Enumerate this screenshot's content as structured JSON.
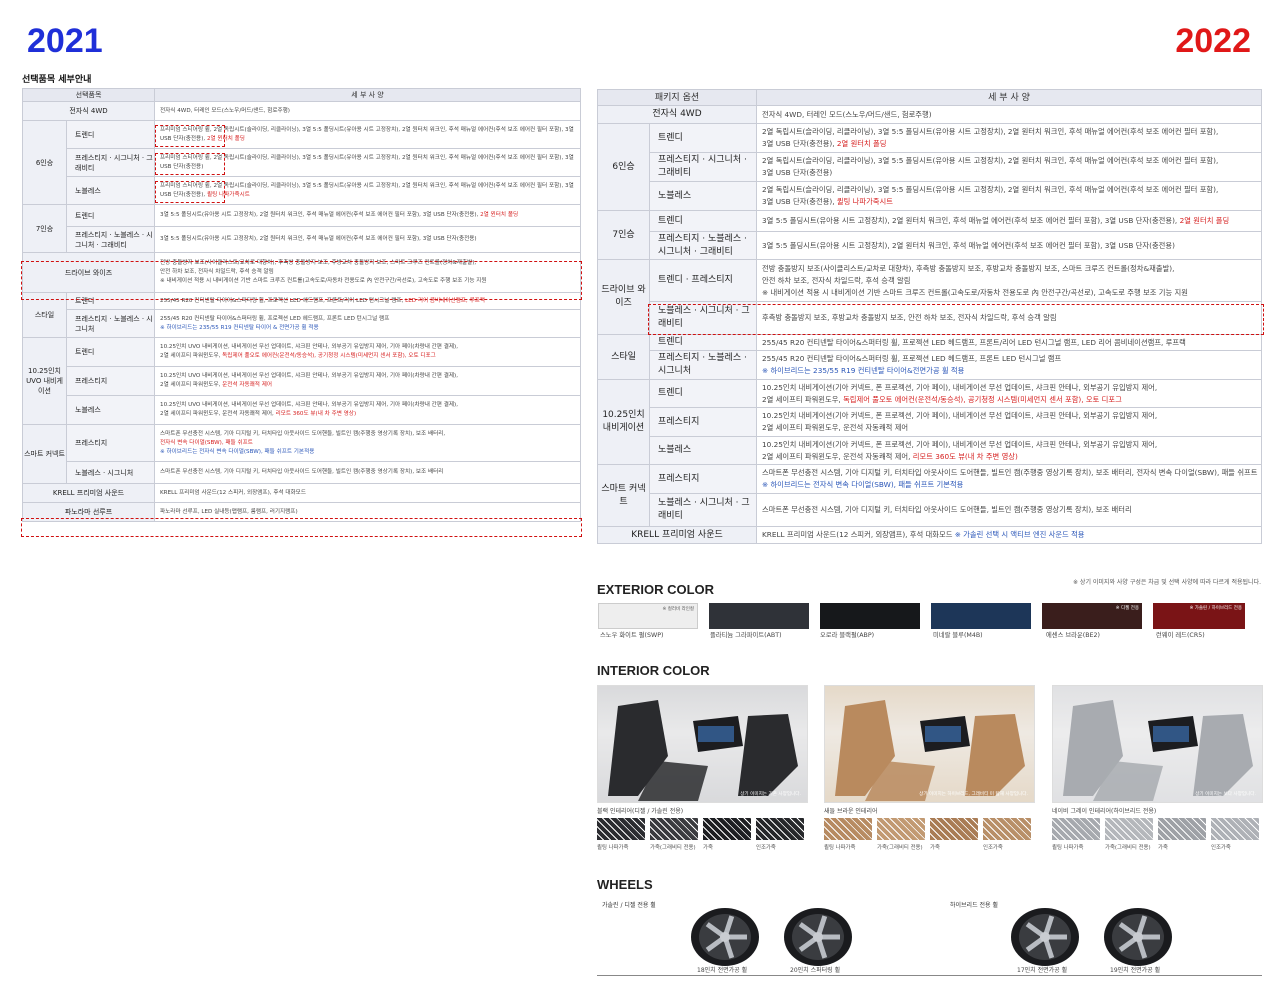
{
  "years": {
    "left": "2021",
    "right": "2022"
  },
  "left_table": {
    "section_title": "선택품목 세부안내",
    "headers": [
      "선택품목",
      "세 부 사 양"
    ],
    "awd": {
      "name": "전자식 4WD",
      "spec": "전자식 4WD, 터레인 모드(스노우/머드/샌드, 험로주행)"
    },
    "six_seat": {
      "group": "6인승",
      "trendy": {
        "name": "트렌디",
        "spec": "프리미엄 스티어링 휠, 2열 독립시트(슬라이딩, 리클라이닝), 3열 5:5 폴딩시트(유아용 시트 고정장치), 2열 원터치 워크인, 후석 매뉴얼 에어컨(후석 보조 에어컨 필터 포함), 3열 USB 단자(충전용),",
        "spec_red": "2열 윈터치 폴딩"
      },
      "prestige": {
        "name": "프레스티지 · 시그니처 · 그래비티",
        "spec": "프리미엄 스티어링 휠, 2열 독립시트(슬라이딩, 리클라이닝), 3열 5:5 폴딩시트(유아용 시트 고정장치), 2열 원터치 워크인, 후석 매뉴얼 에어컨(후석 보조 에어컨 필터 포함), 3열 USB 단자(충전용)"
      },
      "noblesse": {
        "name": "노블레스",
        "spec": "프리미엄 스티어링 휠, 2열 독립시트(슬라이딩, 리클라이닝), 3열 5:5 폴딩시트(유아용 시트 고정장치), 2열 원터치 워크인, 후석 매뉴얼 에어컨(후석 보조 에어컨 필터 포함), 3열 USB 단자(충전용),",
        "spec_red": "퀼팅 나파가죽시트"
      }
    },
    "seven_seat": {
      "group": "7인승",
      "trendy": {
        "name": "트렌디",
        "spec": "3열 5:5 폴딩시트(유아용 시트 고정장치), 2열 원터치 워크인, 후석 매뉴얼 에어컨(후석 보조 에어컨 필터 포함), 3열 USB 단자(충전용),",
        "spec_red": "2열 윈터치 폴딩"
      },
      "prestige": {
        "name": "프레스티지 · 노블레스 · 시그니처 · 그래비티",
        "spec": "3열 5:5 폴딩시트(유아용 시트 고정장치), 2열 원터치 워크인, 후석 매뉴얼 에어컨(후석 보조 에어컨 필터 포함), 3열 USB 단자(충전용)"
      }
    },
    "drive_wise": {
      "name": "드라이브 와이즈",
      "spec1": "전방 충돌방지 보조(사이클리스트/교차로 대향차), 후측방 충돌방지 보조, 후방교차 충돌방지 보조, 스마트 크루즈 컨트롤(정차&재출발),",
      "spec2": "안전 하차 보조, 전자식 차일드락, 후석 승객 알림",
      "spec3": "※ 내비게이션 적용 시 내비게이션 기반 스마트 크루즈 컨트롤(고속도로/자동차 전용도로 內 안전구간/곡선로), 고속도로 주행 보조 기능 지원"
    },
    "style": {
      "group": "스타일",
      "trendy": {
        "name": "트렌디",
        "spec": "255/45 R20 컨티넨탈 타이어&스퍼터링 휠, 프로젝션 LED 헤드램프, 프론트/리어 LED 턴시그널 램프,",
        "spec_red": "LED 리어 콤비네이션램프, 루프랙"
      },
      "prestige": {
        "name": "프레스티지 · 노블레스 · 시그니처",
        "spec": "255/45 R20 컨티넨탈 타이어&스퍼터링 휠, 프로젝션 LED 헤드램프, 프론트 LED 턴시그널 램프",
        "spec_blue": "※ 하이브리드는 235/55 R19 컨티넨탈 타이어 & 전면가공 휠 적용"
      }
    },
    "nav": {
      "group": "10.25인치 UVO 내비게이션",
      "trendy": {
        "name": "트렌디",
        "spec1": "10.25인치 UVO 내비게이션, 내비게이션 무선 업데이트, 샤크핀 안테나, 외부공기 유입방지 제어, 기아 페이(차량내 간편 결제),",
        "spec2": "2열 세이프티 파워윈도우,",
        "spec_red": "독립제어 풀오토 에어컨(운전석/동승석), 공기청정 시스템(미세먼지 센서 포함), 오토 디포그"
      },
      "prestige": {
        "name": "프레스티지",
        "spec1": "10.25인치 UVO 내비게이션, 내비게이션 무선 업데이트, 샤크핀 안테나, 외부공기 유입방지 제어, 기아 페이(차량내 간편 결제),",
        "spec2": "2열 세이프티 파워윈도우,",
        "spec_red": "운전석 자동쾌적 제어"
      },
      "noblesse": {
        "name": "노블레스",
        "spec1": "10.25인치 UVO 내비게이션, 내비게이션 무선 업데이트, 샤크핀 안테나, 외부공기 유입방지 제어, 기아 페이(차량내 간편 결제),",
        "spec2": "2열 세이프티 파워윈도우, 운전석 자동쾌적 제어,",
        "spec_red": "리모트 360도 뷰(내 차 주변 영상)"
      }
    },
    "smart": {
      "group": "스마트 커넥트",
      "prestige": {
        "name": "프레스티지",
        "spec": "스마트폰 무선충전 시스템, 기아 디지털 키, 터치타입 아웃사이드 도어핸들, 빌트인 캠(주행중 영상기록 장치), 보조 배터리,",
        "spec_red": "전자식 변속 다이얼(SBW), 패들 쉬프트",
        "spec_blue": "※ 하이브리드는 전자식 변속 다이얼(SBW), 패들 쉬프트 기본적용"
      },
      "noblesse": {
        "name": "노블레스 · 시그니처",
        "spec": "스마트폰 무선충전 시스템, 기아 디지털 키, 터치타입 아웃사이드 도어핸들, 빌트인 캠(주행중 영상기록 장치), 보조 배터리"
      }
    },
    "krell": {
      "name": "KRELL 프리미엄 사운드",
      "spec": "KRELL 프리미엄 사운드(12 스피커, 외장앰프), 후석 대화모드"
    },
    "panorama": {
      "name": "파노라마 선루프",
      "spec": "파노라마 선루프, LED 실내등(맵램프, 룸램프, 러기지램프)"
    }
  },
  "right_table": {
    "headers": [
      "패키지 옵션",
      "세 부 사 양"
    ],
    "awd": {
      "name": "전자식 4WD",
      "spec": "전자식 4WD, 터레인 모드(스노우/머드/샌드, 험로주행)"
    },
    "six_seat": {
      "group": "6인승",
      "trendy": {
        "name": "트렌디",
        "spec1": "2열 독립시트(슬라이딩, 리클라이닝), 3열 5:5 폴딩시트(유아용 시트 고정장치), 2열 원터치 워크인, 후석 매뉴얼 에어컨(후석 보조 에어컨 필터 포함),",
        "spec2": "3열 USB 단자(충전용),",
        "spec_red": "2열 원터치 폴딩"
      },
      "prestige": {
        "name": "프레스티지 · 시그니처 · 그래비티",
        "spec1": "2열 독립시트(슬라이딩, 리클라이닝), 3열 5:5 폴딩시트(유아용 시트 고정장치), 2열 원터치 워크인, 후석 매뉴얼 에어컨(후석 보조 에어컨 필터 포함),",
        "spec2": "3열 USB 단자(충전용)"
      },
      "noblesse": {
        "name": "노블레스",
        "spec1": "2열 독립시트(슬라이딩, 리클라이닝), 3열 5:5 폴딩시트(유아용 시트 고정장치), 2열 원터치 워크인, 후석 매뉴얼 에어컨(후석 보조 에어컨 필터 포함),",
        "spec2": "3열 USB 단자(충전용),",
        "spec_red": "퀼팅 나파가죽시트"
      }
    },
    "seven_seat": {
      "group": "7인승",
      "trendy": {
        "name": "트렌디",
        "spec": "3열 5:5 폴딩시트(유아용 시트 고정장치), 2열 원터치 워크인, 후석 매뉴얼 에어컨(후석 보조 에어컨 필터 포함), 3열 USB 단자(충전용),",
        "spec_red": "2열 원터치 폴딩"
      },
      "prestige": {
        "name": "프레스티지 · 노블레스 · 시그니처 · 그래비티",
        "spec": "3열 5:5 폴딩시트(유아용 시트 고정장치), 2열 원터치 워크인, 후석 매뉴얼 에어컨(후석 보조 에어컨 필터 포함), 3열 USB 단자(충전용)"
      }
    },
    "drive_wise": {
      "group": "드라이브 와이즈",
      "trendy": {
        "name": "트렌디 · 프레스티지",
        "spec1": "전방 충돌방지 보조(사이클리스트/교차로 대향차), 후측방 충돌방지 보조, 후방교차 충돌방지 보조, 스마트 크루즈 컨트롤(정차&재출발),",
        "spec2": "안전 하차 보조, 전자식 차일드락, 후석 승객 알림",
        "spec3": "※ 내비게이션 적용 시 내비게이션 기반 스마트 크루즈 컨트롤(고속도로/자동차 전용도로 內 안전구간/곡선로), 고속도로 주행 보조 기능 지원"
      },
      "noblesse": {
        "name": "노블레스 · 시그니처 · 그래비티",
        "spec": "후측방 충돌방지 보조, 후방교차 충돌방지 보조, 안전 하차 보조, 전자식 차일드락, 후석 승객 알림"
      }
    },
    "style": {
      "group": "스타일",
      "trendy": {
        "name": "트렌디",
        "spec": "255/45 R20 컨티넨탈 타이어&스퍼터링 휠, 프로젝션 LED 헤드램프, 프론트/리어 LED 턴시그널 램프, LED 리어 콤비네이션램프, 루프랙"
      },
      "prestige": {
        "name": "프레스티지 · 노블레스 · 시그니처",
        "spec": "255/45 R20 컨티넨탈 타이어&스퍼터링 휠, 프로젝션 LED 헤드램프, 프론트 LED 턴시그널 램프",
        "spec_blue": "※ 하이브리드는 235/55 R19 컨티넨탈 타이어&전면가공 휠 적용"
      }
    },
    "nav": {
      "group": "10.25인치 내비게이션",
      "trendy": {
        "name": "트렌디",
        "spec1": "10.25인치 내비게이션(기아 커넥트, 폰 프로젝션, 기아 페이), 내비게이션 무선 업데이트, 샤크핀 안테나, 외부공기 유입방지 제어,",
        "spec2": "2열 세이프티 파워윈도우,",
        "spec_red": "독립제어 풀오토 에어컨(운전석/동승석), 공기청정 시스템(미세먼지 센서 포함), 오토 디포그"
      },
      "prestige": {
        "name": "프레스티지",
        "spec1": "10.25인치 내비게이션(기아 커넥트, 폰 프로젝션, 기아 페이), 내비게이션 무선 업데이트, 샤크핀 안테나, 외부공기 유입방지 제어,",
        "spec2": "2열 세이프티 파워윈도우, 운전석 자동쾌적 제어"
      },
      "noblesse": {
        "name": "노블레스",
        "spec1": "10.25인치 내비게이션(기아 커넥트, 폰 프로젝션, 기아 페이), 내비게이션 무선 업데이트, 샤크핀 안테나, 외부공기 유입방지 제어,",
        "spec2": "2열 세이프티 파워윈도우, 운전석 자동쾌적 제어,",
        "spec_red": "리모트 360도 뷰(내 차 주변 영상)"
      }
    },
    "smart": {
      "group": "스마트 커넥트",
      "prestige": {
        "name": "프레스티지",
        "spec": "스마트폰 무선충전 시스템, 기아 디지털 키, 터치타입 아웃사이드 도어핸들, 빌트인 캠(주행중 영상기록 장치), 보조 배터리, 전자식 변속 다이얼(SBW), 패들 쉬프트",
        "spec_blue": "※ 하이브리드는 전자식 변속 다이얼(SBW), 패들 쉬프트 기본적용"
      },
      "noblesse": {
        "name": "노블레스 · 시그니처 · 그래비티",
        "spec": "스마트폰 무선충전 시스템, 기아 디지털 키, 터치타입 아웃사이드 도어핸들, 빌트인 캠(주행중 영상기록 장치), 보조 배터리"
      }
    },
    "krell": {
      "name": "KRELL 프리미엄 사운드",
      "spec": "KRELL 프리미엄 사운드(12 스피커, 외장앰프), 후석 대화모드",
      "spec_blue": "※ 가솔린 선택 시 액티브 엔진 사운드 적용"
    }
  },
  "exterior": {
    "title": "EXTERIOR COLOR",
    "note": "※ 상기 이미지와 사양 구성은 차급 및 선택 사양에 따라 다르게 적용됩니다.",
    "colors": [
      {
        "name": "스노우 화이트 펄(SWP)",
        "hex": "#eeeeee",
        "tag": "※ 컬러비 라인컬"
      },
      {
        "name": "플라티늄 그라파이트(ABT)",
        "hex": "#2f3238",
        "tag": ""
      },
      {
        "name": "오로라 블랙펄(ABP)",
        "hex": "#16181b",
        "tag": ""
      },
      {
        "name": "미네랄 블루(M4B)",
        "hex": "#1d3658",
        "tag": ""
      },
      {
        "name": "에센스 브라운(BE2)",
        "hex": "#3a1e1c",
        "tag": "※ 디젤 전용"
      },
      {
        "name": "런웨이 레드(CR5)",
        "hex": "#7a1416",
        "tag": "※ 가솔린 / 하이브리드 전용"
      }
    ]
  },
  "interior": {
    "title": "INTERIOR COLOR",
    "caption": "상기 이미지는 기존 사양입니다.",
    "items": [
      {
        "name": "블랙 인테리어(디젤 / 가솔린 전용)",
        "seat": "#2a2b2e",
        "bg": "#d9dadc",
        "textures": [
          {
            "label": "퀼팅 나파가죽",
            "hex": "#2b2c30"
          },
          {
            "label": "가죽(그래비티 전용)",
            "hex": "#3a3b3f"
          },
          {
            "label": "가죽",
            "hex": "#1e1f22"
          },
          {
            "label": "인조가죽",
            "hex": "#26272a"
          }
        ]
      },
      {
        "name": "새들 브라운 인테리어",
        "seat": "#b98a5e",
        "bg": "#e5d9c9",
        "textures": [
          {
            "label": "퀼팅 나파가죽",
            "hex": "#b78b62"
          },
          {
            "label": "가죽(그래비티 전용)",
            "hex": "#c29a72"
          },
          {
            "label": "가죽",
            "hex": "#a97c55"
          },
          {
            "label": "인조가죽",
            "hex": "#b88f68"
          }
        ]
      },
      {
        "name": "네이비 그레이 인테리어(하이브리드 전용)",
        "seat": "#a8abb0",
        "bg": "#e0e1e3",
        "textures": [
          {
            "label": "퀼팅 나파가죽",
            "hex": "#a6a9ae"
          },
          {
            "label": "가죽(그래비티 전용)",
            "hex": "#b4b7bb"
          },
          {
            "label": "가죽",
            "hex": "#9ea1a6"
          },
          {
            "label": "인조가죽",
            "hex": "#aeb1b6"
          }
        ]
      }
    ],
    "captions": [
      "상기 이미지는 기존 사양입니다.",
      "상기 이미지는 하이브리드, 그래비티 미 탑재 사양입니다.",
      "상기 이미지는 보다 사양입니다."
    ]
  },
  "wheels": {
    "title": "WHEELS",
    "groups": [
      "가솔린 / 디젤 전용 휠",
      "하이브리드 전용 휠"
    ],
    "items": [
      "18인치 전면가공 휠",
      "20인치 스퍼터링 휠",
      "17인치 전면가공 휠",
      "19인치 전면가공 휠"
    ]
  }
}
